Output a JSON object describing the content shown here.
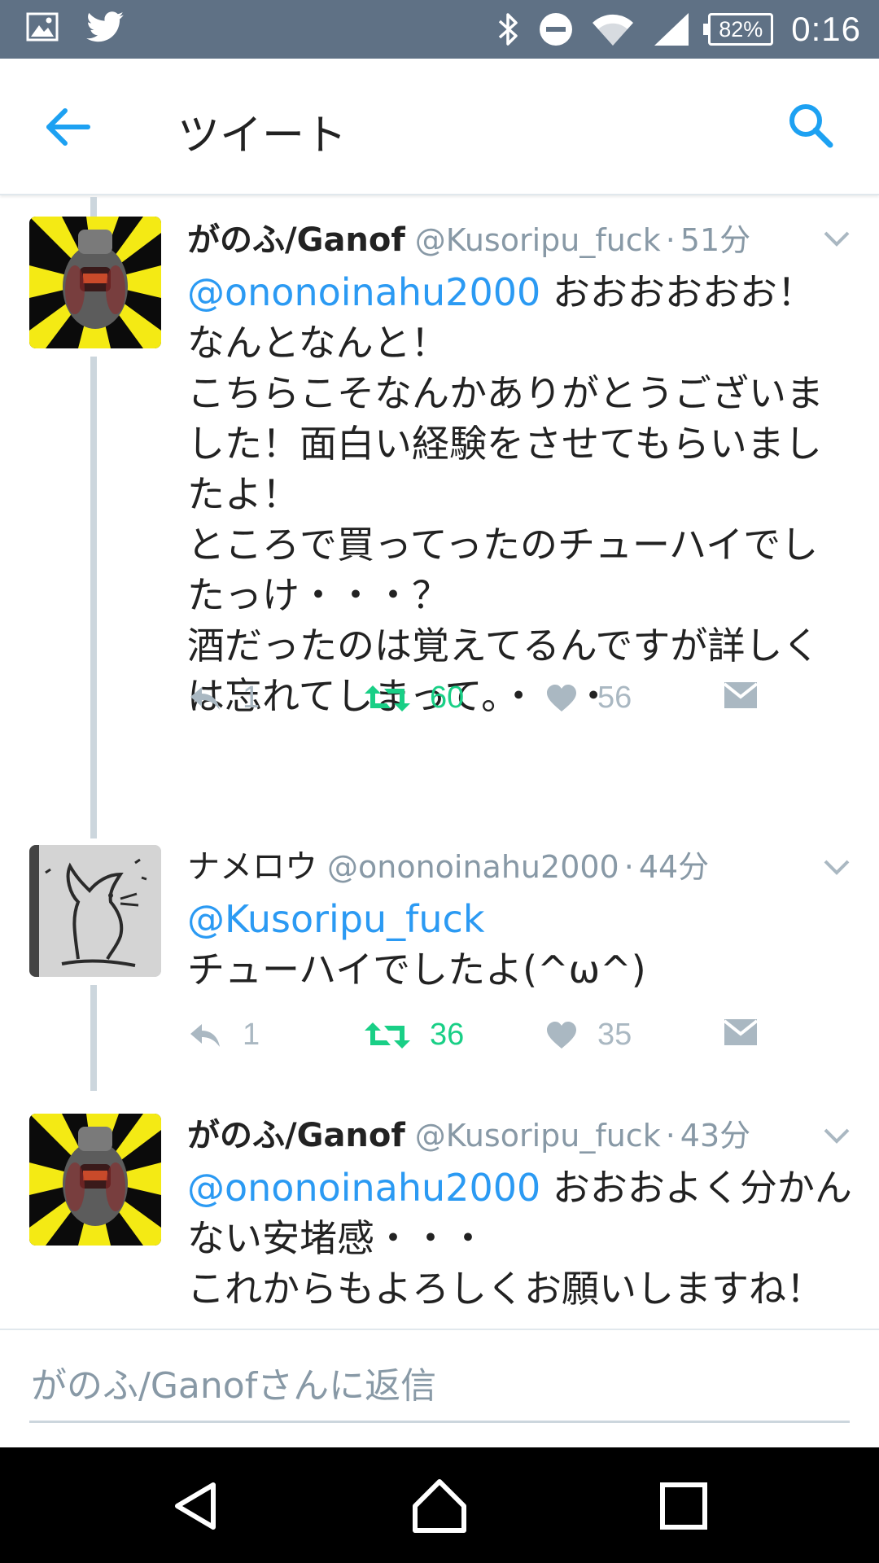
{
  "status_bar": {
    "time": "0:16",
    "battery": "82%",
    "icons": [
      "image-icon",
      "twitter-icon",
      "bluetooth-icon",
      "do-not-disturb-icon",
      "wifi-icon",
      "signal-icon",
      "battery-icon"
    ]
  },
  "app_bar": {
    "title": "ツイート",
    "back_icon": "arrow-left-icon",
    "search_icon": "search-icon",
    "accent_color": "#1da1f2"
  },
  "tweets": [
    {
      "name": "がのふ/Ganof",
      "handle": "@Kusoripu_fuck",
      "separator": "·",
      "time": "51分",
      "mention": "@ononoinahu2000",
      "text_after_mention": " おおおおおお！\nなんとなんと！\nこちらこそなんかありがとうございました！面白い経験をさせてもらいましたよ！\nところで買ってったのチューハイでしたっけ・・・？\n酒だったのは覚えてるんですが詳しくは忘れてしまって。・・・",
      "reply_count": "1",
      "retweet_count": "60",
      "like_count": "56"
    },
    {
      "name": "ナメロウ",
      "handle": "@ononoinahu2000",
      "separator": "·",
      "time": "44分",
      "mention": "@Kusoripu_fuck",
      "text_after_mention": "\nチューハイでしたよ(^ω^)",
      "reply_count": "1",
      "retweet_count": "36",
      "like_count": "35"
    },
    {
      "name": "がのふ/Ganof",
      "handle": "@Kusoripu_fuck",
      "separator": "·",
      "time": "43分",
      "mention": "@ononoinahu2000",
      "text_after_mention": " おおおよく分かんない安堵感・・・\nこれからもよろしくお願いしますね！"
    }
  ],
  "colors": {
    "retweet_green": "#19cf86",
    "mention_blue": "#2b9af3",
    "muted_gray": "#aab8c2",
    "thread_line": "#ccd6dd"
  },
  "reply_box": {
    "placeholder": "がのふ/Ganofさんに返信"
  },
  "nav_bar": {
    "buttons": [
      "back-triangle-icon",
      "home-icon",
      "recents-icon"
    ]
  }
}
